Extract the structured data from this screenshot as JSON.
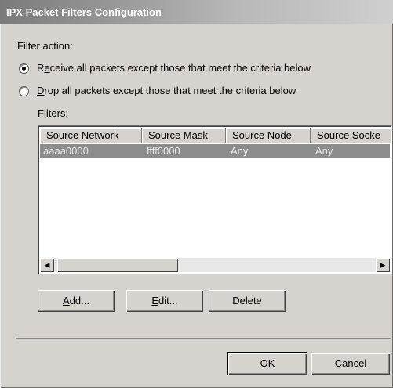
{
  "window": {
    "title": "IPX Packet Filters Configuration"
  },
  "filter_action": {
    "label": "Filter action:",
    "options": [
      {
        "label_prefix": "R",
        "label_key": "e",
        "label_rest": "ceive all packets except those that meet the criteria below",
        "checked": true
      },
      {
        "label_prefix": "",
        "label_key": "D",
        "label_rest": "rop all packets except those that meet the criteria below",
        "checked": false
      }
    ]
  },
  "filters": {
    "label_key": "F",
    "label_rest": "ilters:",
    "columns": [
      "Source Network",
      "Source Mask",
      "Source Node",
      "Source Socke"
    ],
    "rows": [
      [
        "aaaa0000",
        "ffff0000",
        "Any",
        "Any"
      ]
    ],
    "scroll_left_icon": "arrow-left-icon",
    "scroll_right_icon": "arrow-right-icon"
  },
  "buttons": {
    "add": {
      "key": "A",
      "rest": "dd..."
    },
    "edit": {
      "key": "E",
      "rest": "dit..."
    },
    "delete": "Delete",
    "ok": "OK",
    "cancel": "Cancel"
  }
}
